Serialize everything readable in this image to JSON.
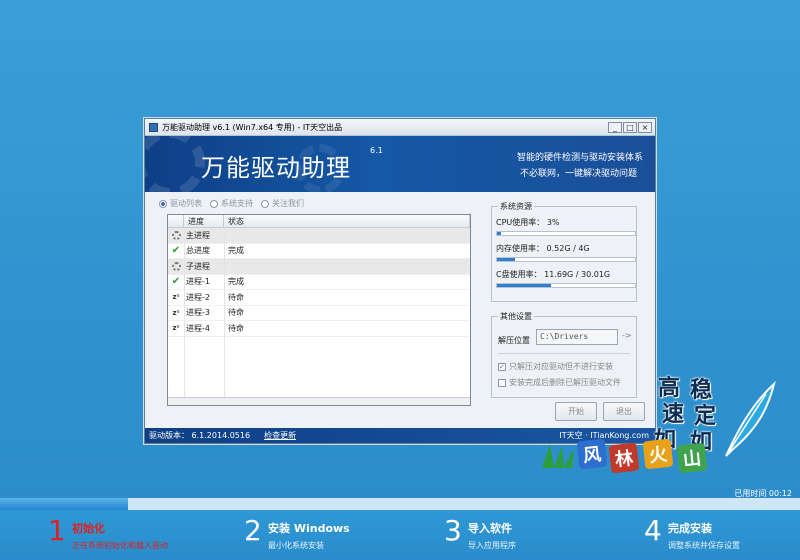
{
  "window": {
    "title": "万能驱动助理 v6.1 (Win7.x64 专用) - IT天空出品",
    "btn_min": "_",
    "btn_max": "□",
    "btn_close": "×"
  },
  "banner": {
    "product": "万能驱动助理",
    "version": "6.1",
    "tagline1": "智能的硬件检测与驱动安装体系",
    "tagline2": "不必联网，一键解决驱动问题"
  },
  "radios": [
    {
      "label": "驱动列表",
      "selected": true
    },
    {
      "label": "系统支持",
      "selected": false
    },
    {
      "label": "关注我们",
      "selected": false
    }
  ],
  "list": {
    "headers": [
      "",
      "进度",
      "状态"
    ],
    "rows": [
      {
        "icon": "gear",
        "name": "主进程",
        "status": "",
        "group": true
      },
      {
        "icon": "check",
        "name": "总进度",
        "status": "完成",
        "group": false
      },
      {
        "icon": "gear",
        "name": "子进程",
        "status": "",
        "group": true
      },
      {
        "icon": "check",
        "name": "进程-1",
        "status": "完成",
        "group": false
      },
      {
        "icon": "sleep",
        "name": "进程-2",
        "status": "待命",
        "group": false
      },
      {
        "icon": "sleep",
        "name": "进程-3",
        "status": "待命",
        "group": false
      },
      {
        "icon": "sleep",
        "name": "进程-4",
        "status": "待命",
        "group": false
      }
    ]
  },
  "system": {
    "title": "系统资源",
    "cpu_label": "CPU使用率：",
    "cpu_value": "3%",
    "cpu_fraction": 0.03,
    "mem_label": "内存使用率：",
    "mem_value": "0.52G / 4G",
    "mem_fraction": 0.13,
    "disk_label": "C盘使用率：",
    "disk_value": "11.69G / 30.01G",
    "disk_fraction": 0.39
  },
  "other": {
    "title": "其他设置",
    "path_label": "解压位置",
    "path_value": "C:\\Drivers",
    "browse": "->",
    "opt1": "只解压对应驱动但不进行安装",
    "opt1_checked": true,
    "opt2": "安装完成后删除已解压驱动文件",
    "opt2_checked": false
  },
  "buttons": {
    "start": "开始",
    "exit": "退出"
  },
  "status": {
    "version": "驱动版本： 6.1.2014.0516",
    "check_update": "检查更新",
    "site": "IT天空 · ITianKong.com"
  },
  "deco": {
    "chars": [
      "高",
      "速",
      "稳",
      "定",
      "如",
      "如"
    ],
    "tiles": [
      "风",
      "林",
      "火",
      "山"
    ]
  },
  "elapsed": "已用时间 00:12",
  "progress_fraction": 0.16,
  "steps": [
    {
      "num": "1",
      "name": "初始化",
      "desc": "正在系统初始化和载入驱动",
      "active": true
    },
    {
      "num": "2",
      "name": "安装 Windows",
      "desc": "最小化系统安装",
      "active": false
    },
    {
      "num": "3",
      "name": "导入软件",
      "desc": "导入应用程序",
      "active": false
    },
    {
      "num": "4",
      "name": "完成安装",
      "desc": "调整系统并保存设置",
      "active": false
    }
  ],
  "colors": {
    "active_step": "#e02020",
    "accent": "#2f7fd1",
    "banner": "#1558a6"
  }
}
